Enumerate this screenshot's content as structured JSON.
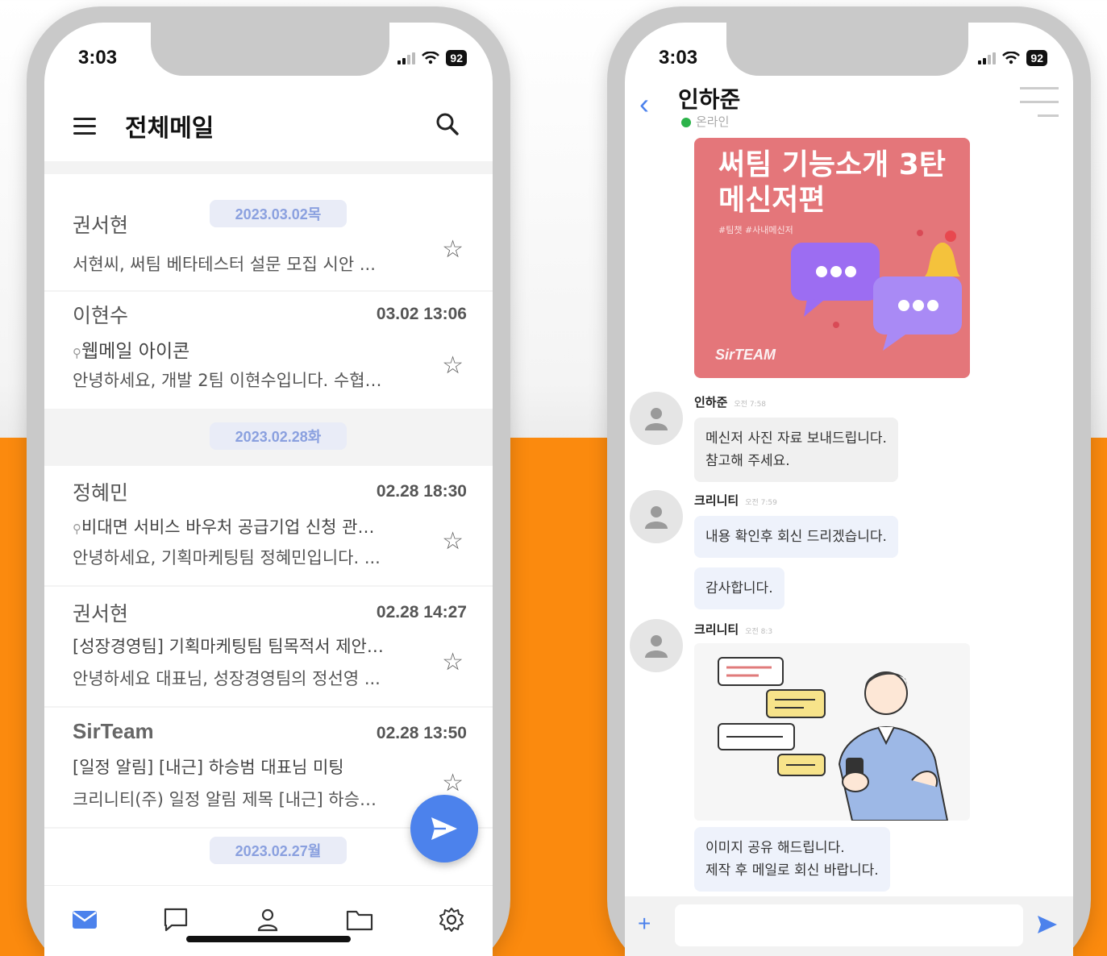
{
  "left_phone": {
    "status": {
      "time": "3:03",
      "battery": "92"
    },
    "header": {
      "title": "전체메일"
    },
    "mails": [
      {
        "date_chip": "2023.03.02목",
        "sender": "권서현",
        "time": "",
        "subject": "",
        "preview": "서현씨, 써팀 베타테스터 설문 모집 시안 ..."
      },
      {
        "date_chip": "",
        "sender": "이현수",
        "time": "03.02 13:06",
        "subject": "웹메일 아이콘",
        "preview": "안녕하세요, 개발 2팀 이현수입니다. 수협…"
      },
      {
        "date_chip": "2023.02.28화",
        "sender": "정혜민",
        "time": "02.28 18:30",
        "subject": "비대면 서비스 바우처 공급기업 신청 관…",
        "preview": "안녕하세요, 기획마케팅팀 정혜민입니다. ..."
      },
      {
        "date_chip": "",
        "sender": "권서현",
        "time": "02.28 14:27",
        "subject": "[성장경영팀] 기획마케팅팀 팀목적서 제안…",
        "preview": "안녕하세요 대표님, 성장경영팀의 정선영 ..."
      },
      {
        "date_chip": "",
        "sender": "SirTeam",
        "time": "02.28 13:50",
        "subject": "[일정 알림] [내근] 하승범 대표님 미팅",
        "preview": "크리니티(주) 일정 알림 제목 [내근] 하승…"
      },
      {
        "date_chip": "2023.02.27월",
        "sender": "",
        "time": "",
        "subject": "",
        "preview": ""
      }
    ],
    "icons": {
      "menu": "hamburger-menu-icon",
      "search": "search-icon",
      "star": "star-outline-icon",
      "compose": "paper-plane-icon",
      "tabs": [
        "mail-icon",
        "chat-icon",
        "person-icon",
        "folder-icon",
        "gear-icon"
      ]
    }
  },
  "right_phone": {
    "status": {
      "time": "3:03",
      "battery": "92"
    },
    "header": {
      "name": "인하준",
      "presence": "온라인"
    },
    "promo": {
      "title_line1": "써팀 기능소개 3탄",
      "title_line2": "메신저편",
      "tags": "#팀챗 #사내메신저",
      "logo": "SirTEAM"
    },
    "messages": [
      {
        "sender": "인하준",
        "time": "오전 7:58",
        "lines": [
          "메신저 사진 자료 보내드립니다.",
          "참고해 주세요."
        ]
      },
      {
        "sender": "크리니티",
        "time": "오전 7:59",
        "lines": [
          "내용 확인후 회신 드리겠습니다."
        ]
      },
      {
        "sender": "",
        "time": "",
        "lines": [
          "감사합니다."
        ]
      },
      {
        "sender": "크리니티",
        "time": "오전 8:3",
        "lines": [
          "이미지 공유 해드립니다.",
          "제작 후 메일로 회신 바랍니다."
        ]
      }
    ],
    "input": {
      "placeholder": ""
    },
    "icons": {
      "back": "chevron-left-icon",
      "add": "plus-icon",
      "send": "send-icon",
      "avatar": "default-avatar-icon"
    }
  },
  "colors": {
    "accent_blue": "#4c82ec",
    "orange_bg": "#fb8a0e",
    "promo_red": "#e4767a",
    "online_green": "#2cb34a"
  }
}
